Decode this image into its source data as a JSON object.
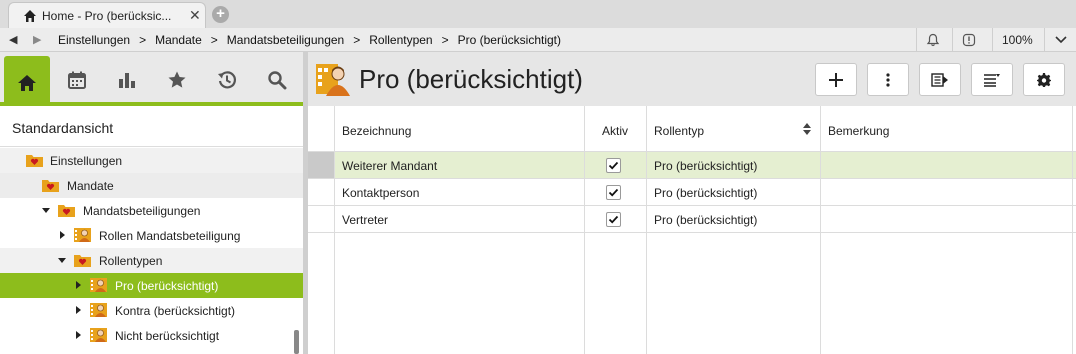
{
  "browser": {
    "tab_title": "Home - Pro (berücksic...",
    "tab_close": "✕"
  },
  "breadcrumb": {
    "items": [
      "Einstellungen",
      "Mandate",
      "Mandatsbeteiligungen",
      "Rollentypen",
      "Pro (berücksichtigt)"
    ],
    "separator": ">",
    "zoom": "100%"
  },
  "sidebar": {
    "view_label": "Standardansicht",
    "nav_icons": [
      "home-icon",
      "calendar-icon",
      "chart-icon",
      "star-icon",
      "history-icon",
      "search-icon"
    ],
    "tree": [
      {
        "label": "Einstellungen",
        "icon": "folder-heart-icon",
        "expander": "none"
      },
      {
        "label": "Mandate",
        "icon": "folder-heart-icon",
        "expander": "none"
      },
      {
        "label": "Mandatsbeteiligungen",
        "icon": "folder-heart-icon",
        "expander": "down"
      },
      {
        "label": "Rollen Mandatsbeteiligung",
        "icon": "person-icon",
        "expander": "right"
      },
      {
        "label": "Rollentypen",
        "icon": "folder-heart-icon",
        "expander": "down"
      },
      {
        "label": "Pro (berücksichtigt)",
        "icon": "person-icon",
        "expander": "right",
        "selected": true
      },
      {
        "label": "Kontra (berücksichtigt)",
        "icon": "person-icon",
        "expander": "right"
      },
      {
        "label": "Nicht berücksichtigt",
        "icon": "person-icon",
        "expander": "right"
      }
    ]
  },
  "main": {
    "title": "Pro (berücksichtigt)",
    "toolbar": [
      "add-icon",
      "more-icon",
      "export-icon",
      "column-settings-icon",
      "settings-gear-icon"
    ],
    "columns": [
      "Bezeichnung",
      "Aktiv",
      "Rollentyp",
      "Bemerkung"
    ],
    "rows": [
      {
        "bezeichnung": "Weiterer Mandant",
        "aktiv": true,
        "rollentyp": "Pro (berücksichtigt)",
        "bemerkung": ""
      },
      {
        "bezeichnung": "Kontaktperson",
        "aktiv": true,
        "rollentyp": "Pro (berücksichtigt)",
        "bemerkung": ""
      },
      {
        "bezeichnung": "Vertreter",
        "aktiv": true,
        "rollentyp": "Pro (berücksichtigt)",
        "bemerkung": ""
      }
    ]
  },
  "colors": {
    "accent": "#8dbd1c",
    "selected_row": "#e5efd1"
  }
}
